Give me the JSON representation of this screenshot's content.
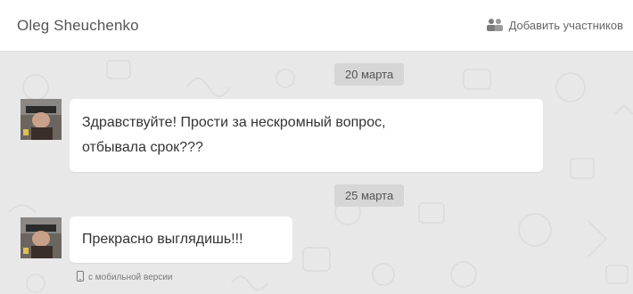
{
  "header": {
    "title": "Oleg Sheuchenko",
    "add_participants_label": "Добавить участников",
    "add_participants_icon": "users-icon"
  },
  "dates": [
    "20 марта",
    "25 марта"
  ],
  "messages": [
    {
      "lines": [
        "Здравствуйте! Прости за нескромный вопрос,",
        "отбывала срок???"
      ]
    },
    {
      "lines": [
        "Прекрасно выглядишь!!!"
      ],
      "footnote": "с мобильной версии",
      "footnote_icon": "mobile-phone-icon"
    }
  ],
  "colors": {
    "chat_background": "#e8e8e8",
    "bubble": "#ffffff",
    "date_pill": "#d6d6d6",
    "header": "#ffffff"
  }
}
